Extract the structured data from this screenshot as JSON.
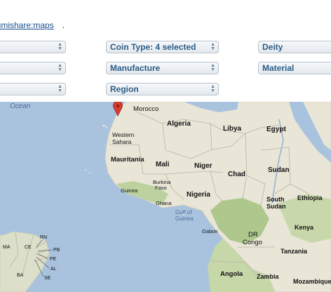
{
  "header": {
    "link_prefix": "...numishare:maps",
    "link_text": "numishare:maps",
    "suffix": "."
  },
  "filters": {
    "row1": [
      "",
      "Coin Type: 4 selected",
      "Deity"
    ],
    "row2": [
      "",
      "Manufacture",
      "Material"
    ],
    "row3": [
      "",
      "Region"
    ]
  },
  "map": {
    "ocean_label": "Ocean",
    "gulf_label": "Gulf of Guinea",
    "countries": [
      "Morocco",
      "Algeria",
      "Libya",
      "Egypt",
      "Western Sahara",
      "Mauritania",
      "Mali",
      "Niger",
      "Chad",
      "Sudan",
      "Burkina Faso",
      "Guinea",
      "Ghana",
      "Nigeria",
      "South Sudan",
      "Ethiopia",
      "Gabon",
      "DR Congo",
      "Kenya",
      "Tanzania",
      "Angola",
      "Zambia",
      "Mozambique"
    ],
    "states": [
      "RN",
      "PB",
      "PE",
      "AL",
      "SE",
      "MA",
      "CE",
      "BA"
    ],
    "colors": {
      "water": "#a9c3df",
      "land": "#e9e6d8",
      "forest": "#b9cf9c",
      "marker": "#d93b2e"
    }
  }
}
